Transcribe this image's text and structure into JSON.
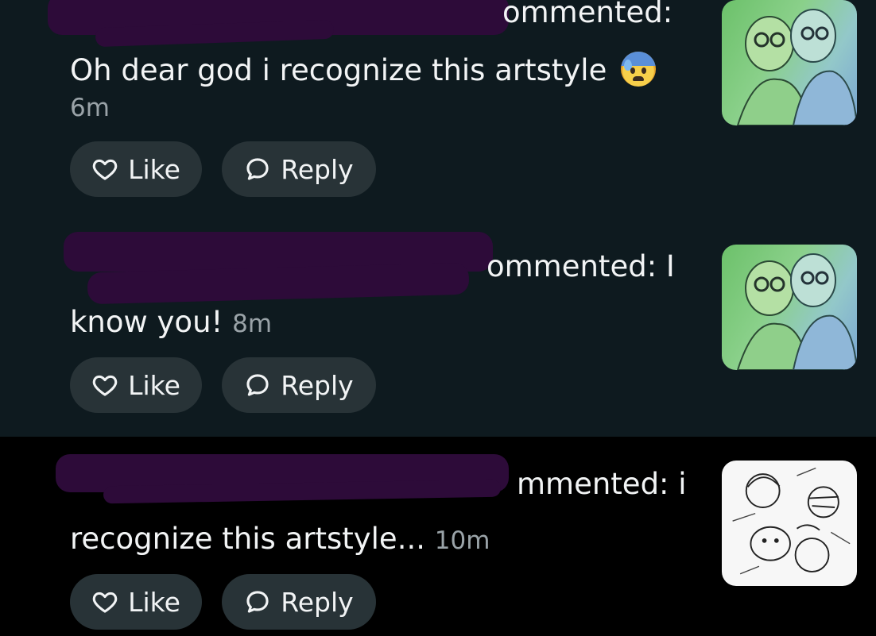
{
  "comments": [
    {
      "action": "ommented:",
      "text": "Oh dear god i recognize this artstyle",
      "emoji": "anxious-face-with-sweat",
      "time": "6m",
      "like_label": "Like",
      "reply_label": "Reply"
    },
    {
      "action": "ommented: I",
      "text": "know you!",
      "time": "8m",
      "like_label": "Like",
      "reply_label": "Reply"
    },
    {
      "action": "mmented: i",
      "text": "recognize this artstyle...",
      "time": "10m",
      "like_label": "Like",
      "reply_label": "Reply"
    }
  ],
  "colors": {
    "background": "#0e1a1f",
    "redaction": "#2d0b39",
    "button_bg": "#283337",
    "text": "#f2f4f5",
    "muted": "#9aa3a8"
  }
}
